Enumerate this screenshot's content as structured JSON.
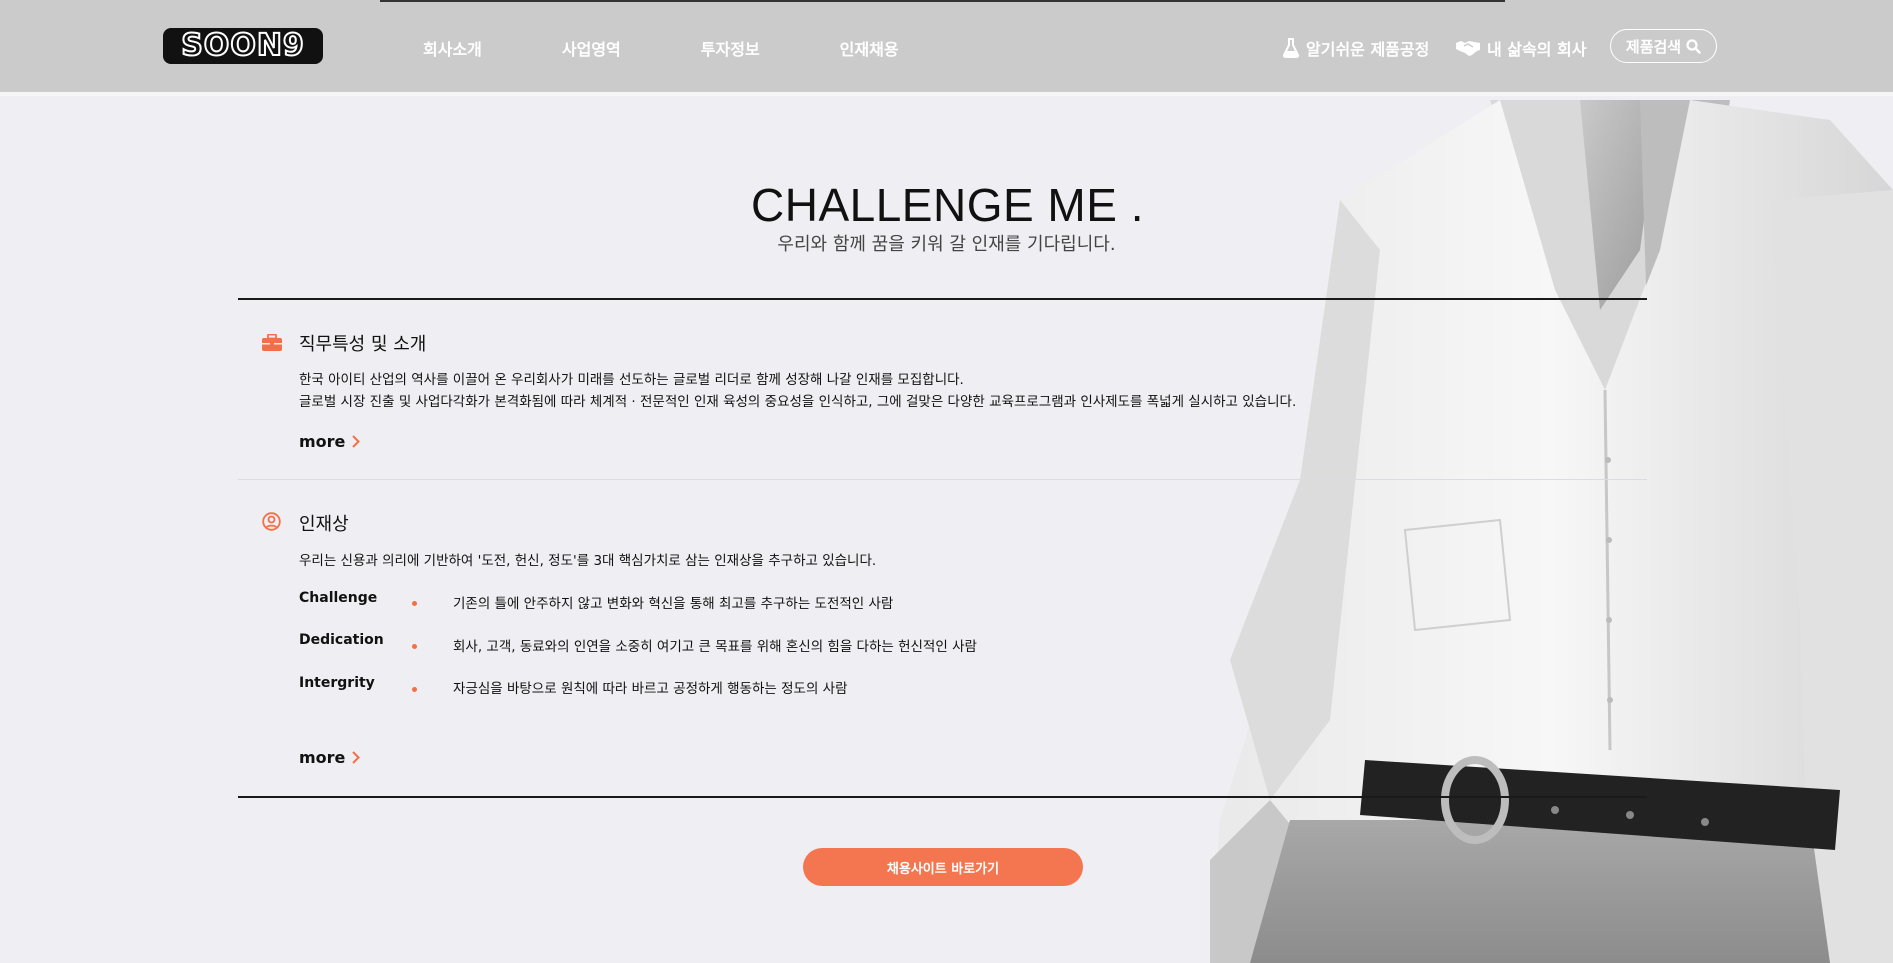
{
  "header": {
    "logo": "SOON9",
    "nav": [
      "회사소개",
      "사업영역",
      "투자정보",
      "인재채용"
    ],
    "util_factory": "알기쉬운 제품공정",
    "util_company": "내 삶속의 회사",
    "search_label": "제품검색"
  },
  "hero": {
    "title": "CHALLENGE ME .",
    "subtitle": "우리와 함께 꿈을 키워 갈 인재를 기다립니다."
  },
  "job": {
    "title": "직무특성 및 소개",
    "lines": [
      "한국 아이티 산업의 역사를 이끌어 온 우리회사가 미래를 선도하는 글로벌 리더로 함께 성장해 나갈 인재를 모집합니다.",
      "글로벌 시장 진출 및 사업다각화가 본격화됨에 따라 체계적 · 전문적인 인재 육성의 중요성을 인식하고, 그에 걸맞은 다양한 교육프로그램과 인사제도를 폭넓게 실시하고 있습니다."
    ],
    "more": "more"
  },
  "talent": {
    "title": "인재상",
    "intro": "우리는 신용과 의리에 기반하여 '도전, 헌신, 정도'를 3대 핵심가치로 삼는 인재상을 추구하고 있습니다.",
    "values": [
      {
        "key": "Challenge",
        "desc": "기존의 틀에 안주하지 않고 변화와 혁신을 통해 최고를 추구하는 도전적인 사람"
      },
      {
        "key": "Dedication",
        "desc": "회사, 고객, 동료와의 인연을 소중히 여기고 큰 목표를 위해 혼신의 힘을 다하는 헌신적인 사람"
      },
      {
        "key": "Intergrity",
        "desc": "자긍심을 바탕으로 원칙에 따라 바르고 공정하게 행동하는 정도의 사람"
      }
    ],
    "more": "more"
  },
  "cta_label": "채용사이트 바로가기",
  "colors": {
    "accent": "#f26f47",
    "header_bg": "#cbcbcb",
    "page_bg": "#efeef2"
  }
}
